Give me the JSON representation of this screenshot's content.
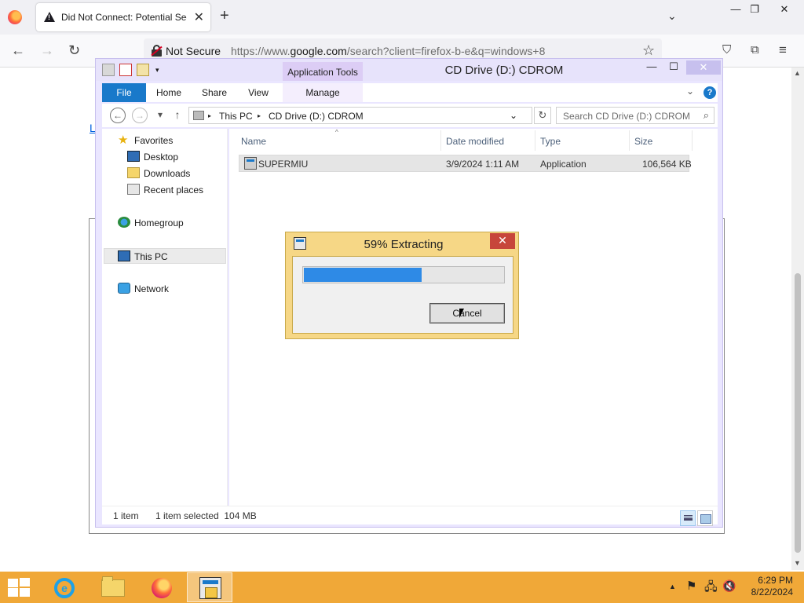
{
  "browser": {
    "tab_title": "Did Not Connect: Potential Sec",
    "tab_close": "✕",
    "new_tab": "+",
    "list_all_tabs": "⌄",
    "window_controls": {
      "minimize": "—",
      "restore": "❐",
      "close": "✕"
    },
    "nav": {
      "back": "←",
      "forward": "→",
      "reload": "↻"
    },
    "security_label": "Not Secure",
    "url_prefix": "https://www.",
    "url_host": "google.com",
    "url_rest": "/search?client=firefox-b-e&q=windows+8",
    "toolbar_icons": [
      "bookmark-star-icon",
      "pocket-icon",
      "extensions-icon",
      "menu-icon"
    ],
    "toolbar_glyphs": {
      "bookmark": "☆",
      "pocket": "⛉",
      "extensions": "⧉",
      "menu": "≡"
    }
  },
  "page": {
    "left_link_text": "L"
  },
  "explorer": {
    "title": "CD Drive (D:) CDROM",
    "contextual_tab_group": "Application Tools",
    "ribbon_tabs": [
      "File",
      "Home",
      "Share",
      "View",
      "Manage"
    ],
    "window_controls": {
      "minimize": "—",
      "maximize": "☐",
      "close": "✕"
    },
    "help": "?",
    "ribbon_chevron": "⌄",
    "address": {
      "back": "←",
      "forward": "→",
      "recent": "▾",
      "up": "↑",
      "breadcrumb": [
        "This PC",
        "CD Drive (D:) CDROM"
      ],
      "separator": "▸",
      "dropdown": "⌄",
      "refresh": "↻",
      "search_placeholder": "Search CD Drive (D:) CDROM",
      "search_icon": "⌕"
    },
    "nav_pane": {
      "items": [
        {
          "label": "Favorites",
          "icon": "star-icon"
        },
        {
          "label": "Desktop",
          "icon": "desktop-icon"
        },
        {
          "label": "Downloads",
          "icon": "downloads-icon"
        },
        {
          "label": "Recent places",
          "icon": "recent-places-icon"
        },
        {
          "label": "Homegroup",
          "icon": "homegroup-icon"
        },
        {
          "label": "This PC",
          "icon": "computer-icon",
          "selected": true
        },
        {
          "label": "Network",
          "icon": "network-icon"
        }
      ]
    },
    "columns": [
      "Name",
      "Date modified",
      "Type",
      "Size"
    ],
    "sort_indicator": "^",
    "files": [
      {
        "name": "SUPERMIU",
        "date_modified": "3/9/2024 1:11 AM",
        "type": "Application",
        "size": "106,564 KB"
      }
    ],
    "status": {
      "item_count": "1 item",
      "selection": "1 item selected  104 MB"
    }
  },
  "extract_dialog": {
    "title": "59% Extracting",
    "progress_percent": 59,
    "cancel_label": "Cancel",
    "close": "✕"
  },
  "taskbar": {
    "apps": [
      "internet-explorer-icon",
      "file-explorer-icon",
      "firefox-icon",
      "setup-app-icon"
    ],
    "tray": {
      "show_hidden": "▲",
      "flag": "⚑",
      "network": "🖧",
      "volume": "🔇"
    },
    "time": "6:29 PM",
    "date": "8/22/2024"
  },
  "colors": {
    "taskbar": "#f0a838",
    "explorer_frame": "#eae6ff",
    "file_tab": "#1979ca",
    "progress_fill": "#2e8ae6",
    "dialog_frame": "#f6d786",
    "dialog_close": "#c7463b"
  }
}
